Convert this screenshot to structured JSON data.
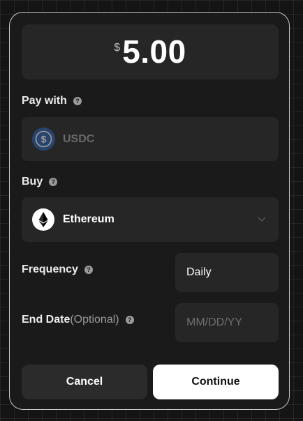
{
  "amount": {
    "currency_symbol": "$",
    "value": "5.00"
  },
  "pay_with": {
    "label": "Pay with",
    "help": "?",
    "asset": "USDC",
    "icon": "usdc-icon"
  },
  "buy": {
    "label": "Buy",
    "help": "?",
    "asset": "Ethereum",
    "icon": "ethereum-icon"
  },
  "frequency": {
    "label": "Frequency",
    "help": "?",
    "value": "Daily"
  },
  "end_date": {
    "label": "End Date",
    "optional": "(Optional)",
    "help": "?",
    "placeholder": "MM/DD/YY"
  },
  "actions": {
    "cancel": "Cancel",
    "continue": "Continue"
  },
  "colors": {
    "card_bg": "#1a1a1a",
    "field_bg": "#262626",
    "usdc_blue": "#2b5ea8",
    "primary_button": "#ffffff"
  }
}
